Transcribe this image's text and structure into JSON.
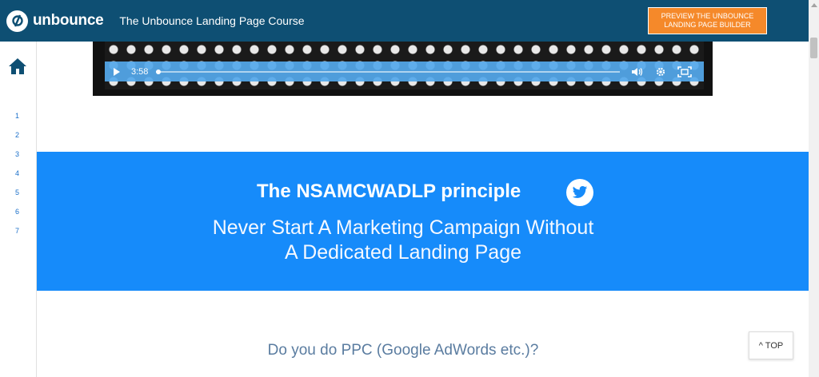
{
  "header": {
    "logo_text": "unbounce",
    "course_title": "The Unbounce Landing Page Course",
    "preview_button": "PREVIEW THE UNBOUNCE LANDING PAGE BUILDER"
  },
  "sidebar": {
    "items": [
      "1",
      "2",
      "3",
      "4",
      "5",
      "6",
      "7"
    ]
  },
  "video": {
    "time": "3:58",
    "progress": 0.0
  },
  "banner": {
    "title": "The NSAMCWADLP principle",
    "line1": "Never Start A Marketing Campaign Without",
    "line2": "A Dedicated Landing Page"
  },
  "section": {
    "question": "Do you do PPC (Google AdWords etc.)?"
  },
  "top_button": "^ TOP",
  "colors": {
    "header_bg": "#0e4f73",
    "accent_orange": "#f5892a",
    "banner_blue": "#168bfa",
    "nav_blue": "#1a6fc9"
  }
}
